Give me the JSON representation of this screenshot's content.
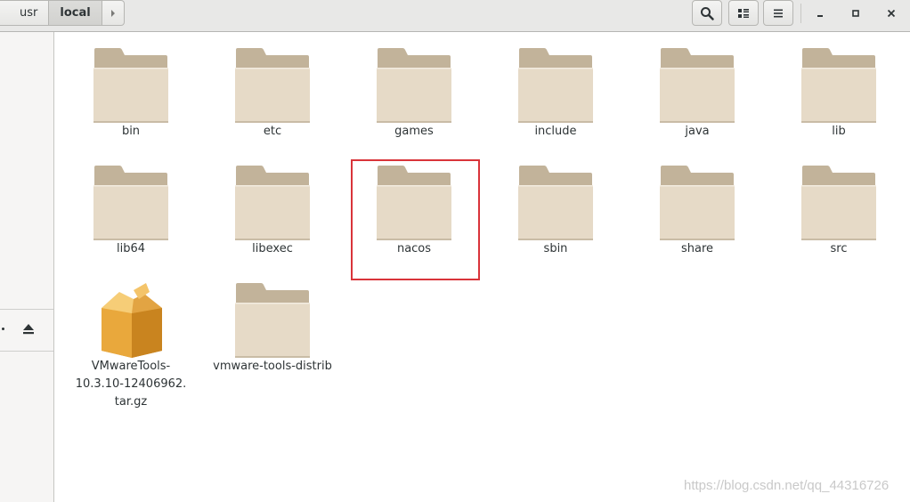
{
  "breadcrumbs": [
    "usr",
    "local"
  ],
  "active_breadcrumb": "local",
  "toolbar": {
    "search_icon": "search-icon",
    "view_icon": "view-list-icon",
    "menu_icon": "menu-icon",
    "minimize_icon": "minimize-icon",
    "maximize_icon": "maximize-icon",
    "close_icon": "close-icon"
  },
  "sidebar": {
    "eject_icon": "eject-icon"
  },
  "files": [
    {
      "name": "bin",
      "type": "folder"
    },
    {
      "name": "etc",
      "type": "folder"
    },
    {
      "name": "games",
      "type": "folder"
    },
    {
      "name": "include",
      "type": "folder"
    },
    {
      "name": "java",
      "type": "folder"
    },
    {
      "name": "lib",
      "type": "folder"
    },
    {
      "name": "lib64",
      "type": "folder"
    },
    {
      "name": "libexec",
      "type": "folder"
    },
    {
      "name": "nacos",
      "type": "folder",
      "highlighted": true
    },
    {
      "name": "sbin",
      "type": "folder"
    },
    {
      "name": "share",
      "type": "folder"
    },
    {
      "name": "src",
      "type": "folder"
    },
    {
      "name": "VMwareTools-10.3.10-12406962.tar.gz",
      "label_lines": [
        "VMwareTools-",
        "10.3.10-12406962.",
        "tar.gz"
      ],
      "type": "archive"
    },
    {
      "name": "vmware-tools-distrib",
      "type": "folder"
    }
  ],
  "highlight_color": "#d9343a",
  "folder_colors": {
    "back": "#c2b39a",
    "front": "#e6dac7"
  },
  "watermark": "https://blog.csdn.net/qq_44316726"
}
